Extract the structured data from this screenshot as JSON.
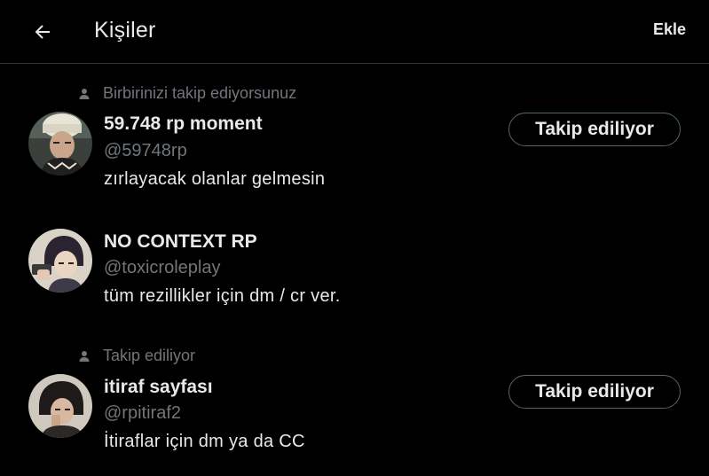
{
  "header": {
    "title": "Kişiler",
    "add_label": "Ekle"
  },
  "users": [
    {
      "context": "Birbirinizi takip ediyorsunuz",
      "name": "59.748 rp moment",
      "handle": "@59748rp",
      "bio": "zırlayacak olanlar gelmesin",
      "follow_label": "Takip ediliyor"
    },
    {
      "name": "NO CONTEXT RP",
      "handle": "@toxicroleplay",
      "bio": "tüm rezillikler için dm / cr ver."
    },
    {
      "context": "Takip ediliyor",
      "name": "itiraf sayfası",
      "handle": "@rpitiraf2",
      "bio": "İtiraflar için dm ya da CC",
      "follow_label": "Takip ediliyor"
    }
  ],
  "colors": {
    "background": "#000000",
    "primary_text": "#e7e9ea",
    "secondary_text": "#71767b",
    "divider": "#2f3336",
    "button_border": "#536471"
  },
  "icons": {
    "back": "arrow-left-icon",
    "context": "person-icon"
  }
}
